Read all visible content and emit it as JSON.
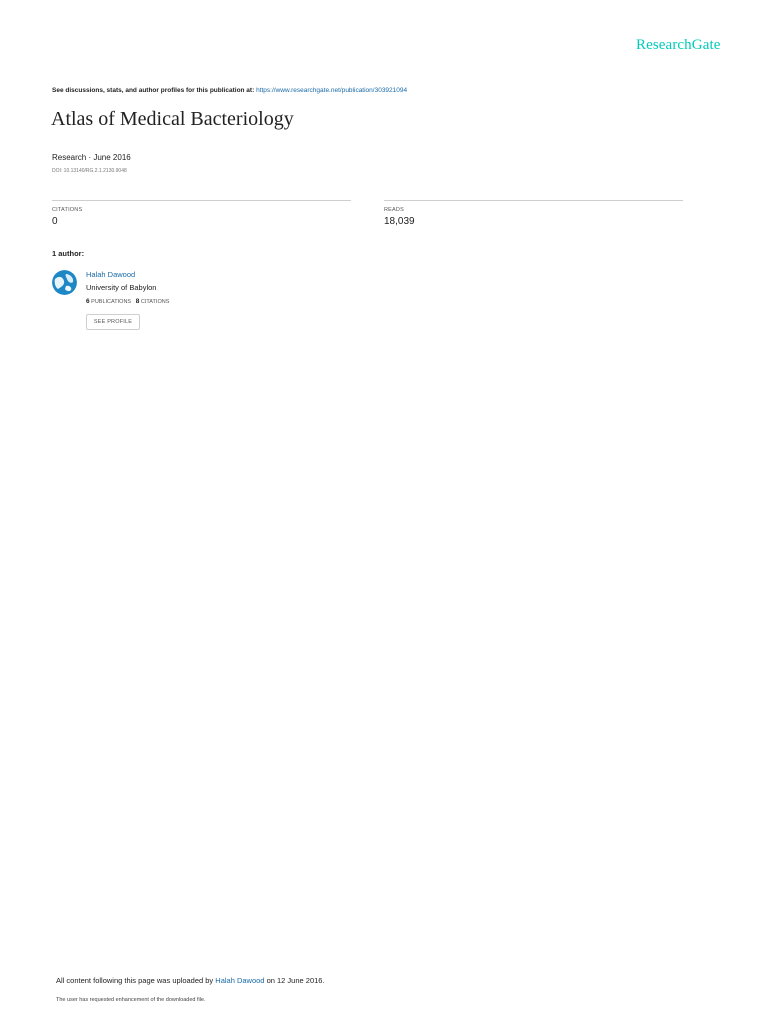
{
  "brand": "ResearchGate",
  "header": {
    "label": "See discussions, stats, and author profiles for this publication at:",
    "url": "https://www.researchgate.net/publication/303921094"
  },
  "publication": {
    "title": "Atlas of Medical Bacteriology",
    "type_date": "Research · June 2016",
    "doi": "DOI: 10.13140/RG.2.1.2130.9048"
  },
  "stats": {
    "citations_label": "CITATIONS",
    "citations_value": "0",
    "reads_label": "READS",
    "reads_value": "18,039"
  },
  "authors": {
    "heading": "1 author:",
    "list": [
      {
        "name": "Halah Dawood",
        "affiliation": "University of Babylon",
        "publications_count": "6",
        "publications_label": "PUBLICATIONS",
        "citations_count": "8",
        "citations_label": "CITATIONS",
        "button_label": "SEE PROFILE"
      }
    ]
  },
  "footer": {
    "upload_prefix": "All content following this page was uploaded by",
    "uploader": "Halah Dawood",
    "upload_suffix": "on 12 June 2016.",
    "request_note": "The user has requested enhancement of the downloaded file."
  },
  "colors": {
    "brand": "#00ccbb",
    "link": "#1a6aa8"
  }
}
